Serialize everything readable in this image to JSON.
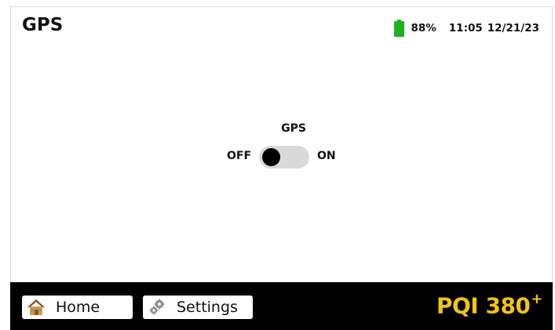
{
  "header": {
    "title": "GPS",
    "battery_percent": "88%",
    "time": "11:05",
    "date": "12/21/23",
    "battery_color": "#1fb21f",
    "battery_icon": "battery-icon"
  },
  "gps_toggle": {
    "title": "GPS",
    "off_label": "OFF",
    "on_label": "ON",
    "state": "off"
  },
  "footer": {
    "home_label": "Home",
    "home_icon": "home-icon",
    "settings_label": "Settings",
    "settings_icon": "gear-icon",
    "brand_text": "PQI 380",
    "brand_sup": "+",
    "brand_color": "#f2c418"
  }
}
